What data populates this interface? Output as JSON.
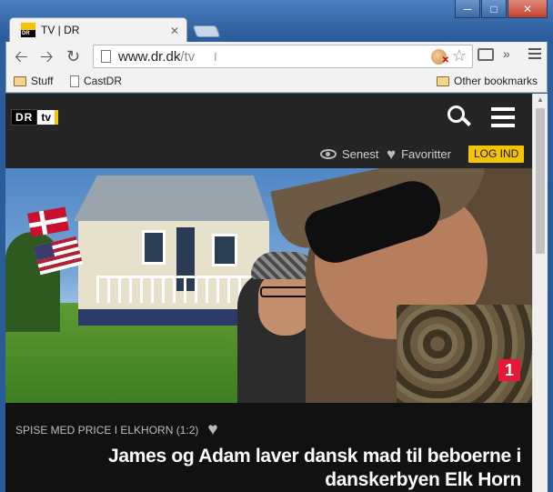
{
  "browser": {
    "tab_title": "TV | DR",
    "favicon_text": "DR",
    "url_host": "www.dr.dk",
    "url_path": "/tv",
    "bookmarks": [
      "Stuff",
      "CastDR"
    ],
    "other_bookmarks": "Other bookmarks"
  },
  "site": {
    "logo_dr": "DR",
    "logo_tv": "tv",
    "nav": {
      "recent": "Senest",
      "favorites": "Favoritter",
      "login": "LOG IND"
    }
  },
  "hero": {
    "channel": "1",
    "program": "SPISE MED PRICE I ELKHORN (1:2)",
    "headline": "James og Adam laver dansk mad til beboerne i danskerbyen Elk Horn"
  },
  "colors": {
    "accent": "#f4c400",
    "channel_red": "#e51937",
    "header_bg": "#252525"
  }
}
